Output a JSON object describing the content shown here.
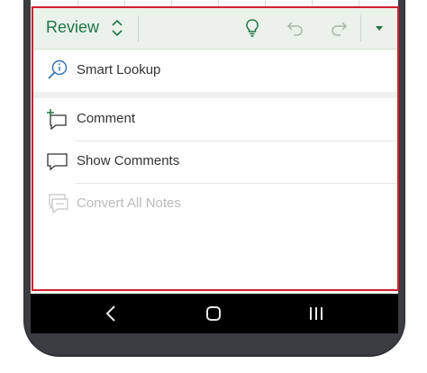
{
  "ribbon": {
    "tab_label": "Review",
    "icons": [
      "chevron-up-down-icon",
      "lightbulb-icon",
      "undo-icon",
      "redo-icon",
      "chevron-down-icon"
    ]
  },
  "menu": {
    "items": [
      {
        "label": "Smart Lookup",
        "icon": "smart-lookup-icon",
        "enabled": true
      },
      {
        "label": "Comment",
        "icon": "new-comment-icon",
        "enabled": true
      },
      {
        "label": "Show Comments",
        "icon": "show-comments-icon",
        "enabled": true
      },
      {
        "label": "Convert All Notes",
        "icon": "convert-notes-icon",
        "enabled": false
      }
    ]
  },
  "navbar": {
    "icons": [
      "back-icon",
      "home-icon",
      "recent-apps-icon"
    ]
  },
  "colors": {
    "accent": "#217346",
    "ribbon_bg": "#eaf2ea",
    "highlight_outline": "#d0202e",
    "disabled_text": "#b9b9b9"
  }
}
